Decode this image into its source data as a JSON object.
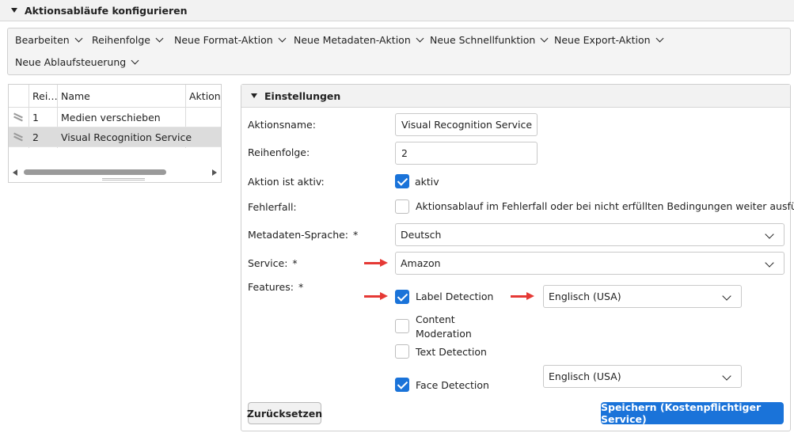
{
  "header": {
    "title": "Aktionsabläufe konfigurieren"
  },
  "toolbar": {
    "menus": [
      "Bearbeiten",
      "Reihenfolge",
      "Neue Format-Aktion",
      "Neue Metadaten-Aktion",
      "Neue Schnellfunktion",
      "Neue Export-Aktion",
      "Neue Ablaufsteuerung"
    ]
  },
  "grid": {
    "columns": [
      "Rei…",
      "Name",
      "Aktions"
    ],
    "rows": [
      {
        "order": "1",
        "name": "Medien verschieben",
        "selected": false
      },
      {
        "order": "2",
        "name": "Visual Recognition Service",
        "selected": true
      }
    ]
  },
  "settings": {
    "title": "Einstellungen",
    "action_name_label": "Aktionsname:",
    "action_name_value": "Visual Recognition Service",
    "order_label": "Reihenfolge:",
    "order_value": "2",
    "active_label": "Aktion ist aktiv:",
    "active_checkbox_label": "aktiv",
    "error_label": "Fehlerfall:",
    "error_checkbox_label": "Aktionsablauf im Fehlerfall oder bei nicht erfüllten Bedingungen weiter ausführen",
    "metadata_lang_label": "Metadaten-Sprache:",
    "metadata_lang_value": "Deutsch",
    "service_label": "Service:",
    "service_value": "Amazon",
    "features_label": "Features:",
    "required_mark": "*",
    "features": [
      {
        "label": "Label Detection",
        "checked": true,
        "language": "Englisch (USA)"
      },
      {
        "label_line1": "Content",
        "label_line2": "Moderation",
        "checked": false
      },
      {
        "label": "Text Detection",
        "checked": false
      },
      {
        "label": "Face Detection",
        "checked": true,
        "language": "Englisch (USA)"
      }
    ]
  },
  "buttons": {
    "reset_label": "Zurücksetzen",
    "save_label": "Speichern (Kostenpflichtiger Service)"
  },
  "colors": {
    "accent": "#1a73d9",
    "annotation_arrow": "#e53935"
  }
}
